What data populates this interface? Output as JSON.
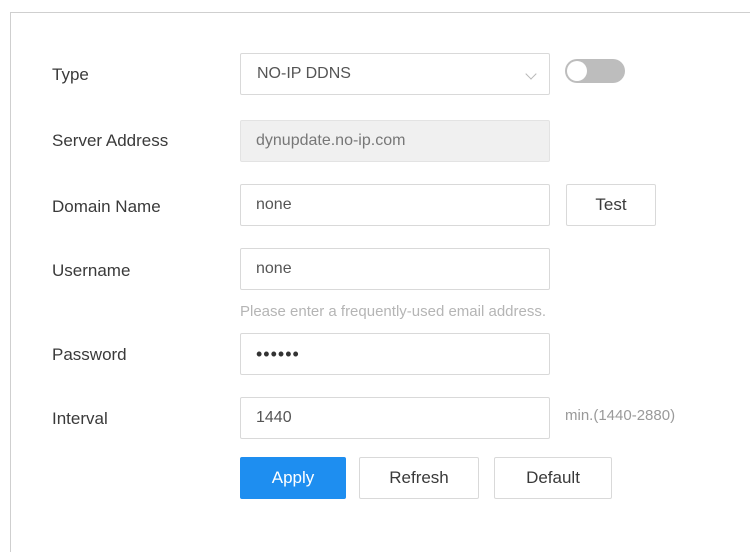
{
  "form": {
    "type": {
      "label": "Type",
      "value": "NO-IP DDNS",
      "toggle_on": false
    },
    "server_address": {
      "label": "Server Address",
      "value": "dynupdate.no-ip.com"
    },
    "domain_name": {
      "label": "Domain Name",
      "value": "none",
      "test_label": "Test"
    },
    "username": {
      "label": "Username",
      "value": "none",
      "hint": "Please enter a frequently-used email address."
    },
    "password": {
      "label": "Password",
      "value": "••••••"
    },
    "interval": {
      "label": "Interval",
      "value": "1440",
      "unit": "min.(1440-2880)"
    }
  },
  "actions": {
    "apply_label": "Apply",
    "refresh_label": "Refresh",
    "default_label": "Default"
  },
  "colors": {
    "primary": "#1e8ef0",
    "toggle_off": "#bdbdbd"
  }
}
